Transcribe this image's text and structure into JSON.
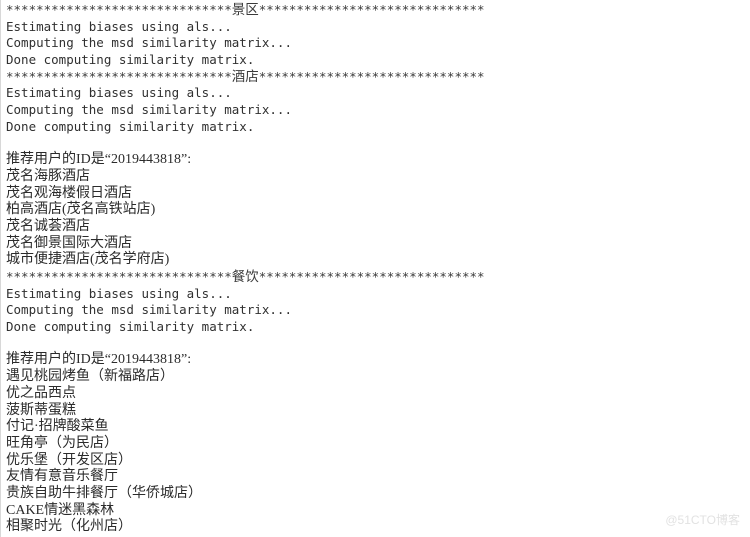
{
  "console": {
    "stars_left": "******************************",
    "stars_right": "******************************",
    "messages": {
      "estimating": "Estimating biases using als...",
      "computing": "Computing the msd similarity matrix...",
      "done": "Done computing similarity matrix."
    },
    "recommend_header": "推荐用户的ID是“2019443818”:",
    "sections": [
      {
        "label": "景区",
        "items": []
      },
      {
        "label": "酒店",
        "items": [
          "茂名海豚酒店",
          "茂名观海楼假日酒店",
          "柏高酒店(茂名高铁站店)",
          "茂名诚荟酒店",
          "茂名御景国际大酒店",
          "城市便捷酒店(茂名学府店)"
        ]
      },
      {
        "label": "餐饮",
        "items": [
          "遇见桃园烤鱼（新福路店）",
          "优之品西点",
          "菠斯蒂蛋糕",
          "付记·招牌酸菜鱼",
          "旺角亭（为民店）",
          "优乐堡（开发区店）",
          "友情有意音乐餐厅",
          "贵族自助牛排餐厅（华侨城店）",
          "CAKE情迷黑森林",
          "相聚时光（化州店）"
        ]
      }
    ]
  },
  "watermark": {
    "text": "@51CTO博客"
  },
  "colors": {
    "background": "#ffffff",
    "text": "#2b2b2b",
    "watermark": "#e2e2e2",
    "border": "#d8d8d8"
  }
}
